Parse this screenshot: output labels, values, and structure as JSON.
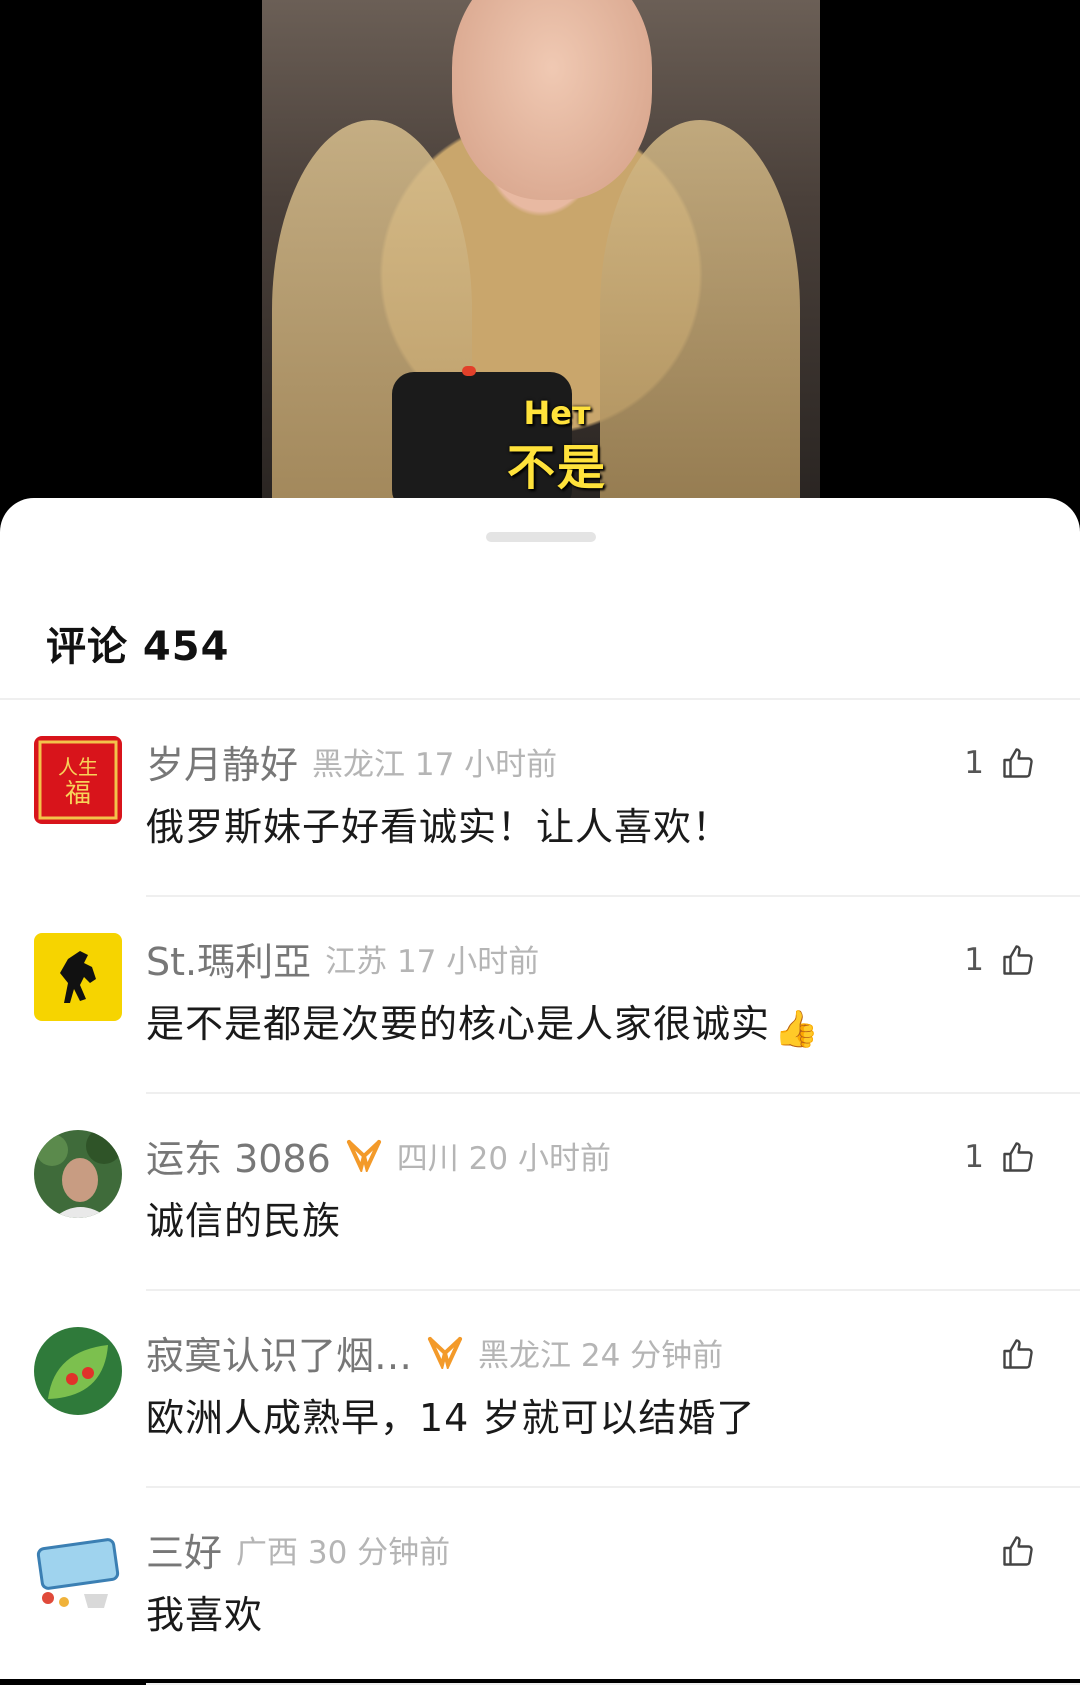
{
  "video": {
    "subtitle_ru": "Нет",
    "subtitle_zh": "不是"
  },
  "sheet": {
    "title": "评论 454"
  },
  "comments": [
    {
      "nickname": "岁月静好",
      "vip": false,
      "location_time": "黑龙江 17 小时前",
      "text": "俄罗斯妹子好看诚实！让人喜欢！",
      "likes": "1",
      "avatar": "red-banner-avatar"
    },
    {
      "nickname": "St.瑪利亞",
      "vip": false,
      "location_time": "江苏 17 小时前",
      "text": "是不是都是次要的核心是人家很诚实",
      "text_emoji": "👍",
      "likes": "1",
      "avatar": "ferrari-horse-avatar"
    },
    {
      "nickname": "运东 3086",
      "vip": true,
      "location_time": "四川 20 小时前",
      "text": "诚信的民族",
      "likes": "1",
      "avatar": "man-photo-avatar"
    },
    {
      "nickname": "寂寞认识了烟…",
      "vip": true,
      "location_time": "黑龙江 24 分钟前",
      "text": "欧洲人成熟早，14 岁就可以结婚了",
      "likes": "",
      "avatar": "green-leaf-avatar"
    },
    {
      "nickname": "三好",
      "vip": false,
      "location_time": "广西 30 分钟前",
      "text": "我喜欢",
      "likes": "",
      "avatar": "cartoon-sign-avatar"
    }
  ],
  "icons": {
    "like": "thumbs-up-outline-icon",
    "vip": "vip-ribbon-icon"
  },
  "colors": {
    "vip": "#f39a2a",
    "subtitle": "#ffe23b",
    "nickname": "#777777",
    "location": "#b5b5b5"
  }
}
